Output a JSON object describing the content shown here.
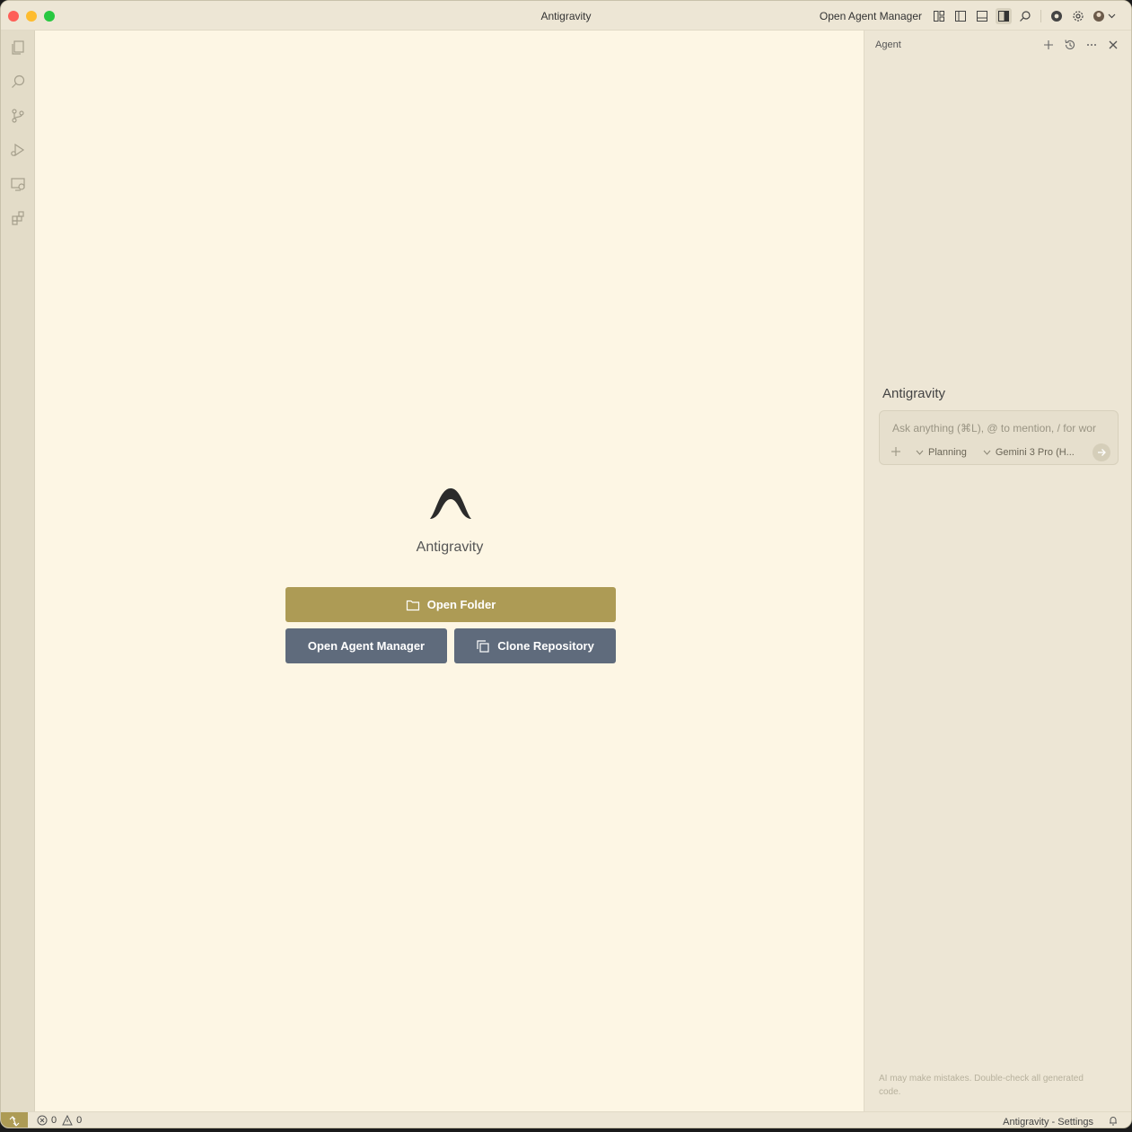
{
  "window": {
    "title": "Antigravity"
  },
  "titlebar": {
    "open_agent_manager": "Open Agent Manager"
  },
  "activity_bar": {
    "items": [
      "explorer-icon",
      "search-icon",
      "source-control-icon",
      "run-debug-icon",
      "remote-explorer-icon",
      "extensions-icon"
    ]
  },
  "editor": {
    "app_name": "Antigravity",
    "open_folder": "Open Folder",
    "open_agent_manager": "Open Agent Manager",
    "clone_repository": "Clone Repository"
  },
  "agent": {
    "header": "Agent",
    "title": "Antigravity",
    "placeholder": "Ask anything (⌘L), @ to mention, / for wor",
    "mode": "Planning",
    "model": "Gemini 3 Pro (H...",
    "disclaimer": "AI may make mistakes. Double-check all generated code."
  },
  "statusbar": {
    "errors": "0",
    "warnings": "0",
    "settings": "Antigravity - Settings"
  },
  "colors": {
    "accent": "#ad9b55",
    "secondary_button": "#5f6b7c",
    "editor_bg": "#fdf6e4",
    "panel_bg": "#ede6d5"
  }
}
